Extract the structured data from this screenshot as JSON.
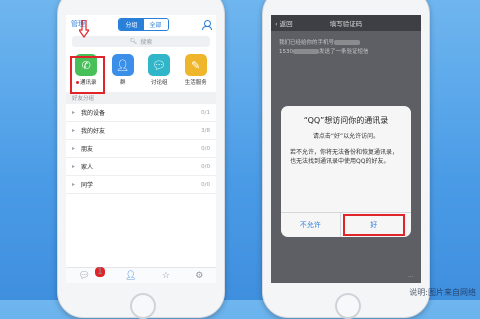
{
  "left": {
    "header": {
      "manage": "管理",
      "seg_group": "分组",
      "seg_all": "全部"
    },
    "search": {
      "placeholder": "搜索"
    },
    "tiles": [
      {
        "label": "通讯录",
        "icon": "phone-icon"
      },
      {
        "label": "群",
        "icon": "group-icon"
      },
      {
        "label": "讨论组",
        "icon": "chat-icon"
      },
      {
        "label": "生活服务",
        "icon": "service-icon"
      }
    ],
    "section": "好友分组",
    "groups": [
      {
        "name": "我的设备",
        "count": "0/1"
      },
      {
        "name": "我的好友",
        "count": "3/8"
      },
      {
        "name": "朋友",
        "count": "0/0"
      },
      {
        "name": "家人",
        "count": "0/0"
      },
      {
        "name": "同学",
        "count": "0/0"
      }
    ],
    "tabbar": {
      "badge": "1"
    }
  },
  "right": {
    "header": {
      "back": "返回",
      "title": "填写验证码"
    },
    "body": {
      "line1": "我们已经给你的手机号",
      "line2_pre": "1530",
      "line2_post": "发送了一条验证短信"
    },
    "dialog": {
      "title": "“QQ”想访问你的通讯录",
      "subtitle": "请点击“好”以允许访问。",
      "body": "若不允许，你将无法备份和恢复通讯录，也无法找到通讯录中使用QQ的好友。",
      "deny": "不允许",
      "allow": "好"
    },
    "footer": "…"
  },
  "watermark": "说明:图片来自网络",
  "colors": {
    "accent": "#2a7fd9",
    "highlight": "#e0252a",
    "background": "#4a9be6"
  }
}
